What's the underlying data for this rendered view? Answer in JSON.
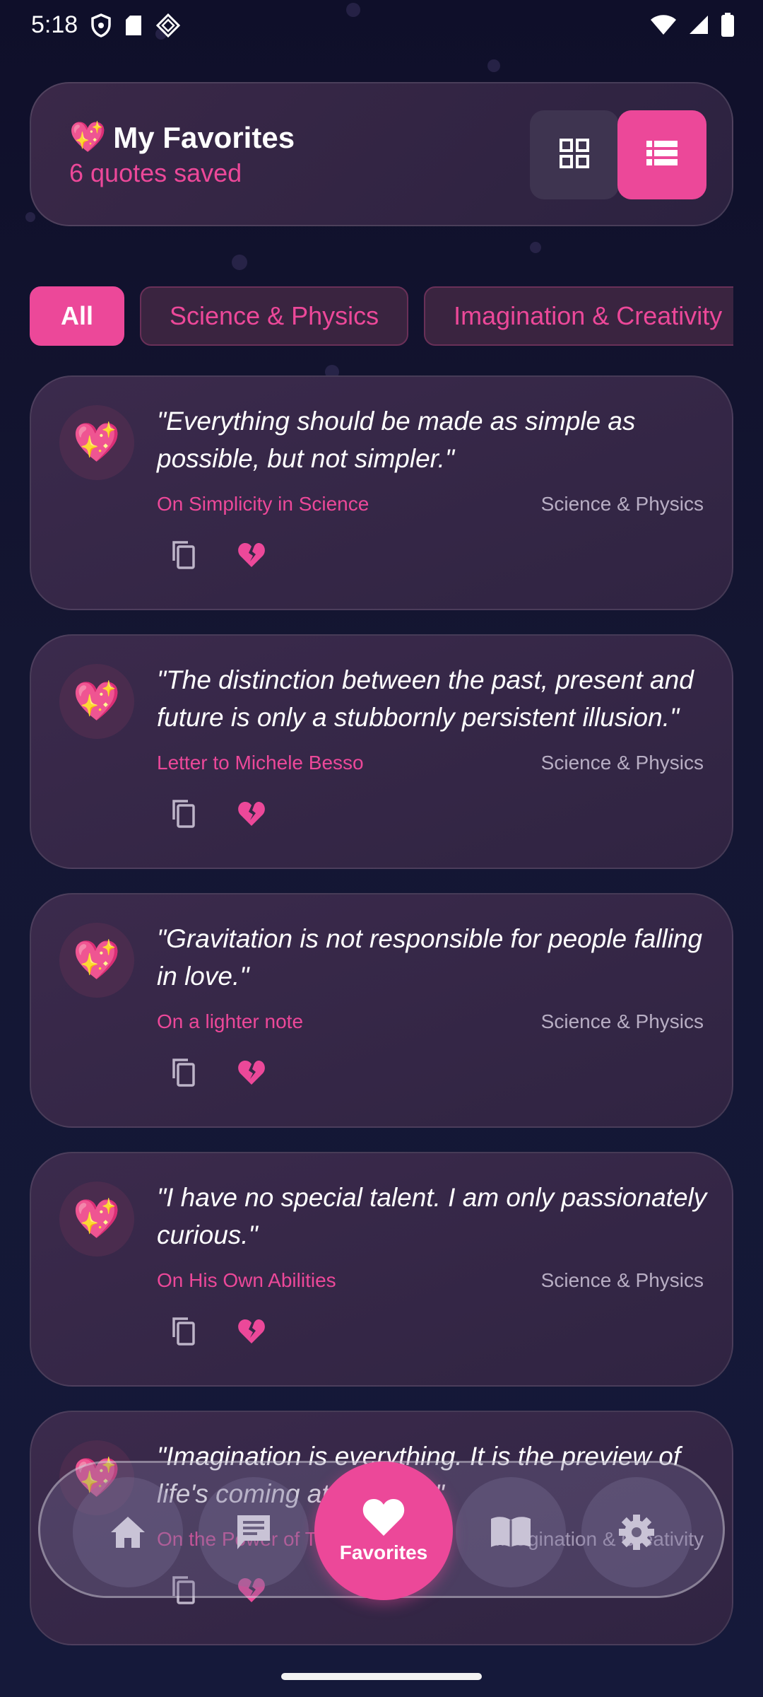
{
  "status_bar": {
    "time": "5:18"
  },
  "header": {
    "emoji": "💖",
    "title": "My Favorites",
    "subtitle": "6 quotes saved",
    "view_options": [
      "grid",
      "list"
    ],
    "active_view": "list"
  },
  "categories": [
    {
      "label": "All",
      "active": true
    },
    {
      "label": "Science & Physics",
      "active": false
    },
    {
      "label": "Imagination & Creativity",
      "active": false
    }
  ],
  "quotes": [
    {
      "emoji": "💖",
      "text": "\"Everything should be made as simple as possible, but not simpler.\"",
      "source": "On Simplicity in Science",
      "category": "Science & Physics"
    },
    {
      "emoji": "💖",
      "text": "\"The distinction between the past, present and future is only a stubbornly persistent illusion.\"",
      "source": "Letter to Michele Besso",
      "category": "Science & Physics"
    },
    {
      "emoji": "💖",
      "text": "\"Gravitation is not responsible for people falling in love.\"",
      "source": "On a lighter note",
      "category": "Science & Physics"
    },
    {
      "emoji": "💖",
      "text": "\"I have no special talent. I am only passionately curious.\"",
      "source": "On His Own Abilities",
      "category": "Science & Physics"
    },
    {
      "emoji": "💖",
      "text": "\"Imagination is everything. It is the preview of life's coming attractions.\"",
      "source": "On the Power of Thought",
      "category": "Imagination & Creativity"
    }
  ],
  "nav": {
    "items": [
      "home-icon",
      "chat-icon",
      "heart-icon",
      "book-icon",
      "gear-icon"
    ],
    "active_label": "Favorites"
  },
  "colors": {
    "accent": "#ec4899",
    "background": "#13152f",
    "card": "#35283f"
  }
}
